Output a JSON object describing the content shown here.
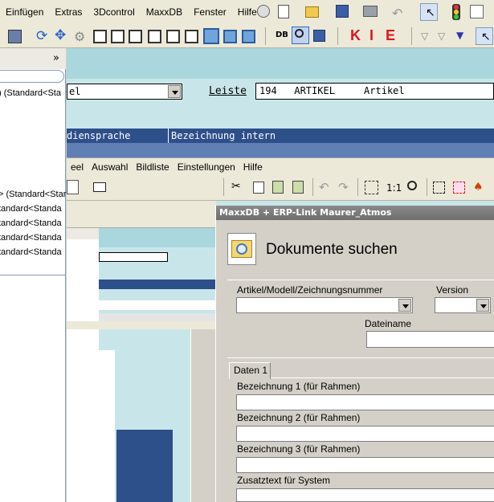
{
  "menubar": {
    "items": [
      "Einfügen",
      "Extras",
      "3Dcontrol",
      "MaxxDB",
      "Fenster",
      "Hilfe"
    ]
  },
  "toolbar": {
    "db_label": "DB",
    "k": "K",
    "i": "I",
    "e": "E"
  },
  "leftpane": {
    "collapse": "»",
    "items": [
      ") (Standard<Sta",
      "> (Standard<Star",
      "tandard<Standa",
      "tandard<Standa",
      "tandard<Standa",
      "tandard<Standa"
    ]
  },
  "form": {
    "field_left_value": "el",
    "leiste_label": "Leiste",
    "leiste_value": "194   ARTIKEL     Artikel",
    "header_col1": "diensprache",
    "header_col2": "Bezeichnung intern"
  },
  "window2": {
    "menu": [
      "eel",
      "Auswahl",
      "Bildliste",
      "Einstellungen",
      "Hilfe"
    ],
    "ratio": "1:1"
  },
  "dialog": {
    "title": "MaxxDB + ERP-Link  Maurer_Atmos",
    "heading": "Dokumente suchen",
    "artikel_label": "Artikel/Modell/Zeichnungsnummer",
    "version_label": "Version",
    "dateiname_label": "Dateiname",
    "tab_label": "Daten 1",
    "bez1_label": "Bezeichnung 1 (für Rahmen)",
    "bez2_label": "Bezeichnung 2 (für Rahmen)",
    "bez3_label": "Bezeichnung 3 (für Rahmen)",
    "zusatz_label": "Zusatztext für System"
  },
  "colors": {
    "accent": "#2d4f8a",
    "form_bg": "#c8e6ea",
    "red": "#e0141e"
  }
}
